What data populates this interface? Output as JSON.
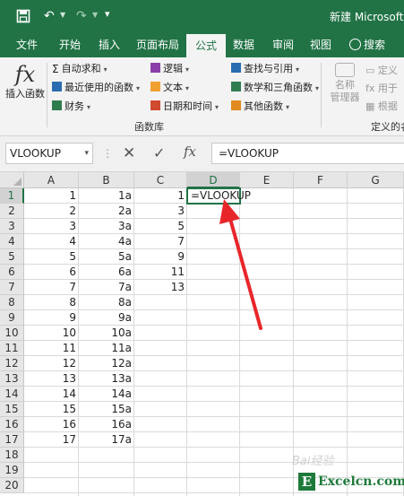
{
  "titlebar": {
    "title": "新建 Microsoft"
  },
  "ribbon_tabs": [
    {
      "label": "文件",
      "active": false
    },
    {
      "label": "开始",
      "active": false
    },
    {
      "label": "插入",
      "active": false
    },
    {
      "label": "页面布局",
      "active": false
    },
    {
      "label": "公式",
      "active": true
    },
    {
      "label": "数据",
      "active": false
    },
    {
      "label": "审阅",
      "active": false
    },
    {
      "label": "视图",
      "active": false
    }
  ],
  "search_label": "搜索",
  "ribbon": {
    "insert_function": "插入函数",
    "autosum": "自动求和",
    "recent": "最近使用的函数",
    "financial": "财务",
    "logical": "逻辑",
    "text": "文本",
    "datetime": "日期和时间",
    "lookup": "查找与引用",
    "math": "数学和三角函数",
    "other": "其他函数",
    "group_label": "函数库",
    "name_manager_1": "名称",
    "name_manager_2": "管理器",
    "define_name": "定义",
    "use_in_formula": "用于",
    "from_selection": "根据",
    "defined_names_label": "定义的名"
  },
  "formula_bar": {
    "name_box": "VLOOKUP",
    "formula": "=VLOOKUP"
  },
  "columns": [
    "A",
    "B",
    "C",
    "D",
    "E",
    "F",
    "G"
  ],
  "rows": [
    "1",
    "2",
    "3",
    "4",
    "5",
    "6",
    "7",
    "8",
    "9",
    "10",
    "11",
    "12",
    "13",
    "14",
    "15",
    "16",
    "17",
    "18",
    "19",
    "20"
  ],
  "cells": {
    "A": [
      "1",
      "2",
      "3",
      "4",
      "5",
      "6",
      "7",
      "8",
      "9",
      "10",
      "11",
      "12",
      "13",
      "14",
      "15",
      "16",
      "17"
    ],
    "B": [
      "1a",
      "2a",
      "3a",
      "4a",
      "5a",
      "6a",
      "7a",
      "8a",
      "9a",
      "10a",
      "11a",
      "12a",
      "13a",
      "14a",
      "15a",
      "16a",
      "17a"
    ],
    "C": [
      "1",
      "3",
      "5",
      "7",
      "9",
      "11",
      "13"
    ],
    "D1": "=VLOOKUP"
  },
  "watermark": {
    "baidu": "Bai经验",
    "logo_letter": "E",
    "logo_text": "Excelcn.com"
  }
}
